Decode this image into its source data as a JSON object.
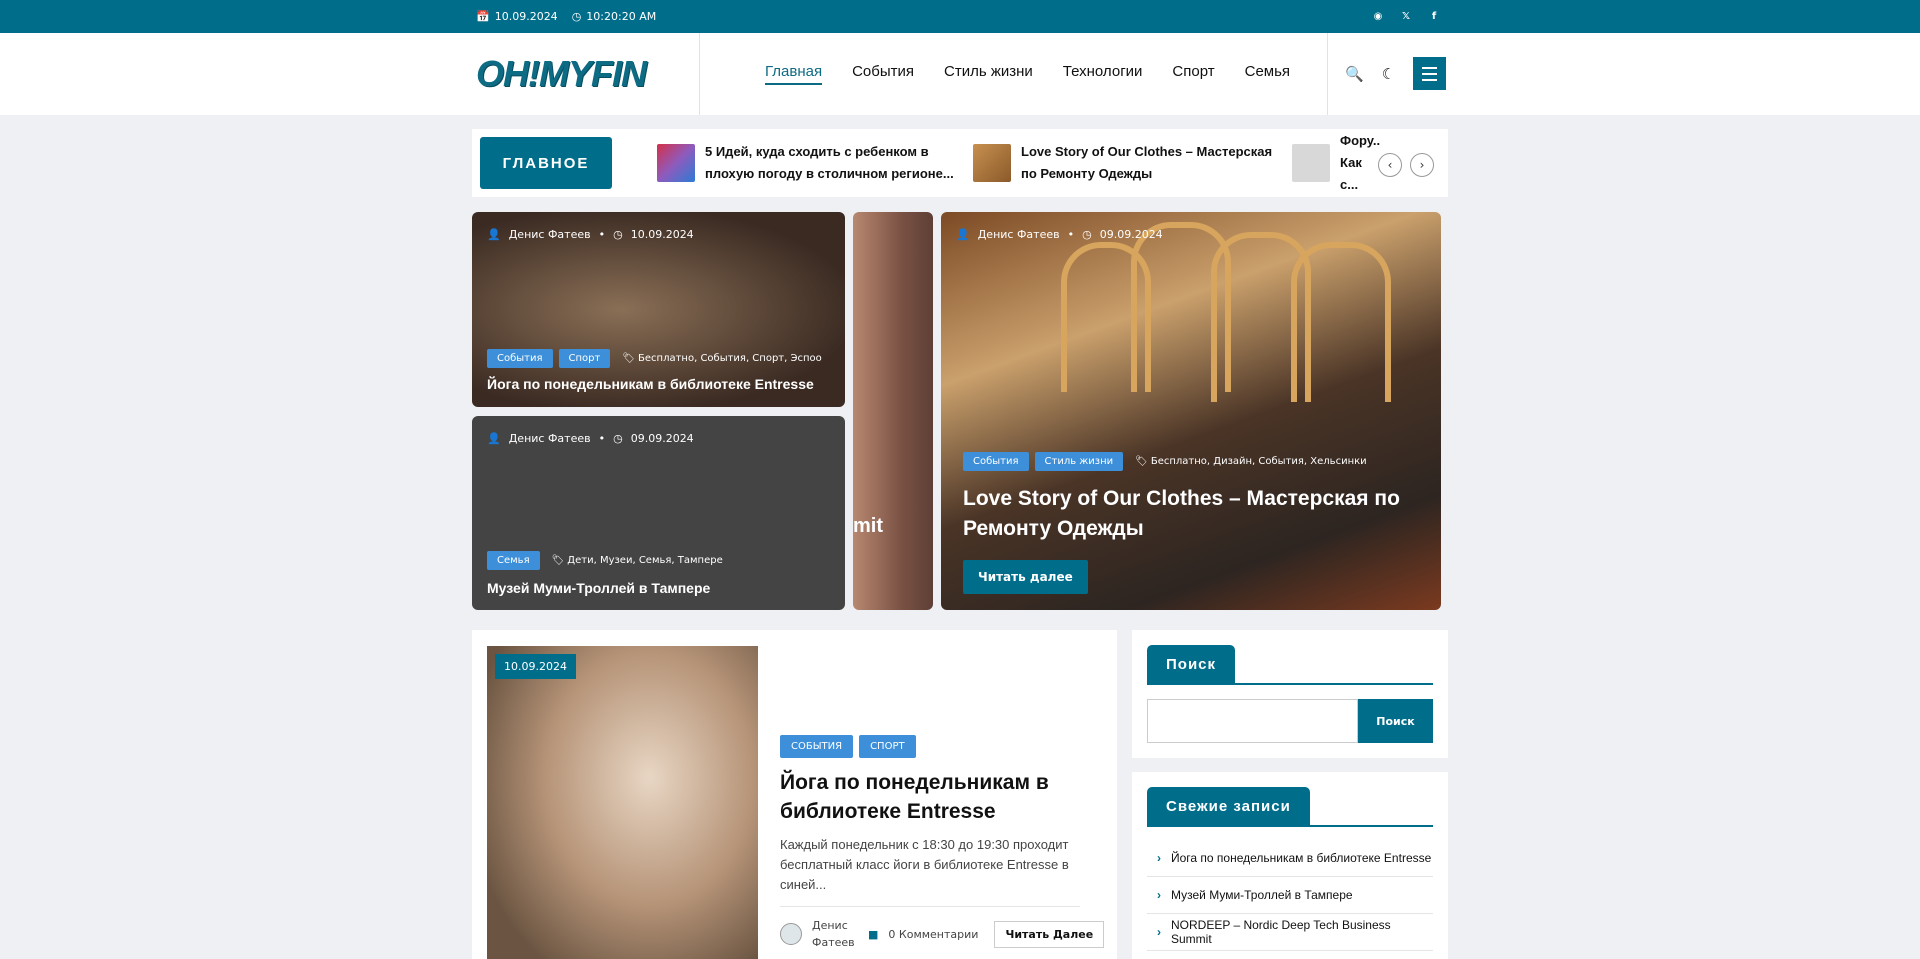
{
  "topbar": {
    "date": "10.09.2024",
    "time": "10:20:20 AM",
    "social": [
      "circle-icon",
      "x-icon",
      "facebook-icon"
    ]
  },
  "header": {
    "logo": "OH!MYFIN",
    "nav": [
      "Главная",
      "События",
      "Стиль жизни",
      "Технологии",
      "Спорт",
      "Семья"
    ],
    "active_nav": "Главная"
  },
  "ticker": {
    "label": "ГЛАВНОЕ",
    "items": [
      "5 Идей, куда сходить с ребенком в плохую погоду в столичном регионе...",
      "Love Story of Our Clothes – Мастерская по Ремонту Одежды",
      "Фору... Как с..."
    ]
  },
  "hero": {
    "card1": {
      "author": "Денис Фатеев",
      "date": "10.09.2024",
      "cats": [
        "События",
        "Спорт"
      ],
      "tags": "Бесплатно, События, Спорт, Эспоо",
      "title": "Йога по понедельникам в библиотеке Entresse"
    },
    "card2": {
      "author": "Денис Фатеев",
      "date": "09.09.2024",
      "cats": [
        "Семья"
      ],
      "tags": "Дети, Музеи, Семья, Тампере",
      "title": "Музей Муми-Троллей в Тампере"
    },
    "strip_partial": "mit",
    "card3": {
      "author": "Денис Фатеев",
      "date": "09.09.2024",
      "cats": [
        "События",
        "Стиль жизни"
      ],
      "tags": "Бесплатно, Дизайн, События, Хельсинки",
      "title": "Love Story of Our Clothes – Мастерская по Ремонту Одежды",
      "button": "Читать далее"
    }
  },
  "post": {
    "date": "10.09.2024",
    "cats": [
      "СОБЫТИЯ",
      "СПОРТ"
    ],
    "title": "Йога по понедельникам в библиотеке Entresse",
    "excerpt": "Каждый понедельник с 18:30 до 19:30 проходит бесплатный класс йоги в библиотеке Entresse в синей...",
    "author": "Денис Фатеев",
    "comments": "0 Комментарии",
    "read_more": "Читать Далее"
  },
  "sidebar": {
    "search": {
      "title": "Поиск",
      "button": "Поиск",
      "placeholder": ""
    },
    "recent": {
      "title": "Свежие записи",
      "items": [
        "Йога по понедельникам в библиотеке Entresse",
        "Музей Муми-Троллей в Тампере",
        "NORDEEP – Nordic Deep Tech Business Summit"
      ]
    }
  },
  "colors": {
    "brand": "#006d8a",
    "badge": "#3d8fd9",
    "background": "#eef0f4"
  }
}
